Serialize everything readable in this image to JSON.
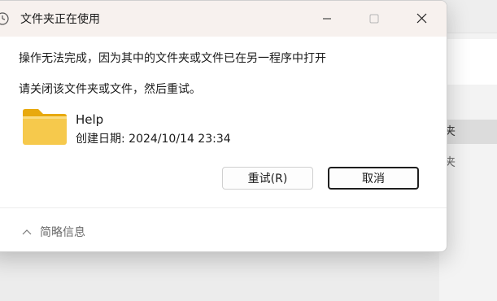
{
  "dialog": {
    "title": "文件夹正在使用",
    "message_line1": "操作无法完成，因为其中的文件夹或文件已在另一程序中打开",
    "message_line2": "请关闭该文件夹或文件，然后重试。",
    "file": {
      "name": "Help",
      "created_label": "创建日期: 2024/10/14 23:34"
    },
    "buttons": {
      "retry": "重试(R)",
      "cancel": "取消"
    },
    "details_toggle": "简略信息"
  },
  "background_window": {
    "items": [
      "夹",
      "夹"
    ]
  },
  "icons": {
    "title": "clock-icon",
    "folder": "folder-icon",
    "minimize": "minimize-icon",
    "maximize": "maximize-icon",
    "close": "close-icon",
    "details": "chevron-up-icon"
  },
  "colors": {
    "titlebar": "#f7f1ee",
    "folder": "#f4c542",
    "selected_item": "#dcdcdc"
  }
}
